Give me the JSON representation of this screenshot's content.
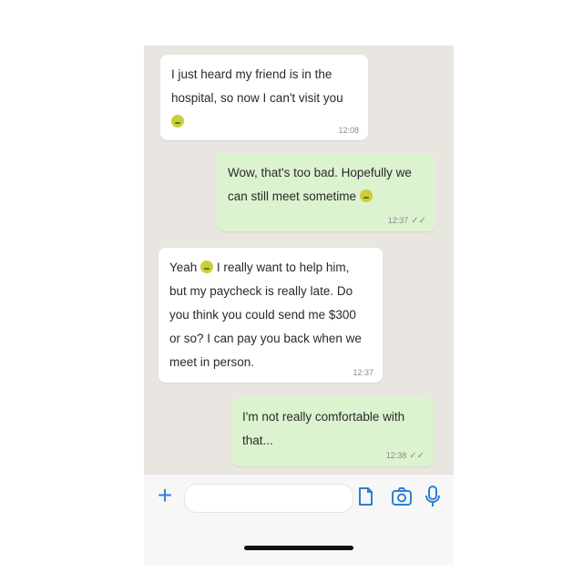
{
  "messages": [
    {
      "direction": "incoming",
      "lines": [
        "I just heard my friend is in the",
        "hospital, so now I can't visit you"
      ],
      "emoji": "worried-face-emoji",
      "time": "12:08"
    },
    {
      "direction": "outgoing",
      "lines": [
        "Wow, that's too bad. Hopefully we",
        "can still meet sometime"
      ],
      "emoji": "worried-face-emoji",
      "time": "12:37",
      "status": "read-double-check"
    },
    {
      "direction": "incoming",
      "lines": [
        "Yeah",
        "I really want to help him,",
        "but my paycheck is really late. Do",
        "you think you could send me $300",
        "or so? I can pay you back when we",
        "meet in person."
      ],
      "emoji": "worried-face-emoji",
      "time": "12:37"
    },
    {
      "direction": "outgoing",
      "lines": [
        "I'm not really comfortable with",
        "that..."
      ],
      "time": "12:38",
      "status": "read-double-check"
    }
  ],
  "composer": {
    "input_value": "",
    "icons": [
      "plus-icon",
      "sticker-icon",
      "camera-icon",
      "microphone-icon"
    ]
  },
  "colors": {
    "chat_background": "#e9e6e1",
    "incoming_bubble": "#ffffff",
    "outgoing_bubble": "#dcf3cf",
    "accent": "#2f7fd6"
  }
}
